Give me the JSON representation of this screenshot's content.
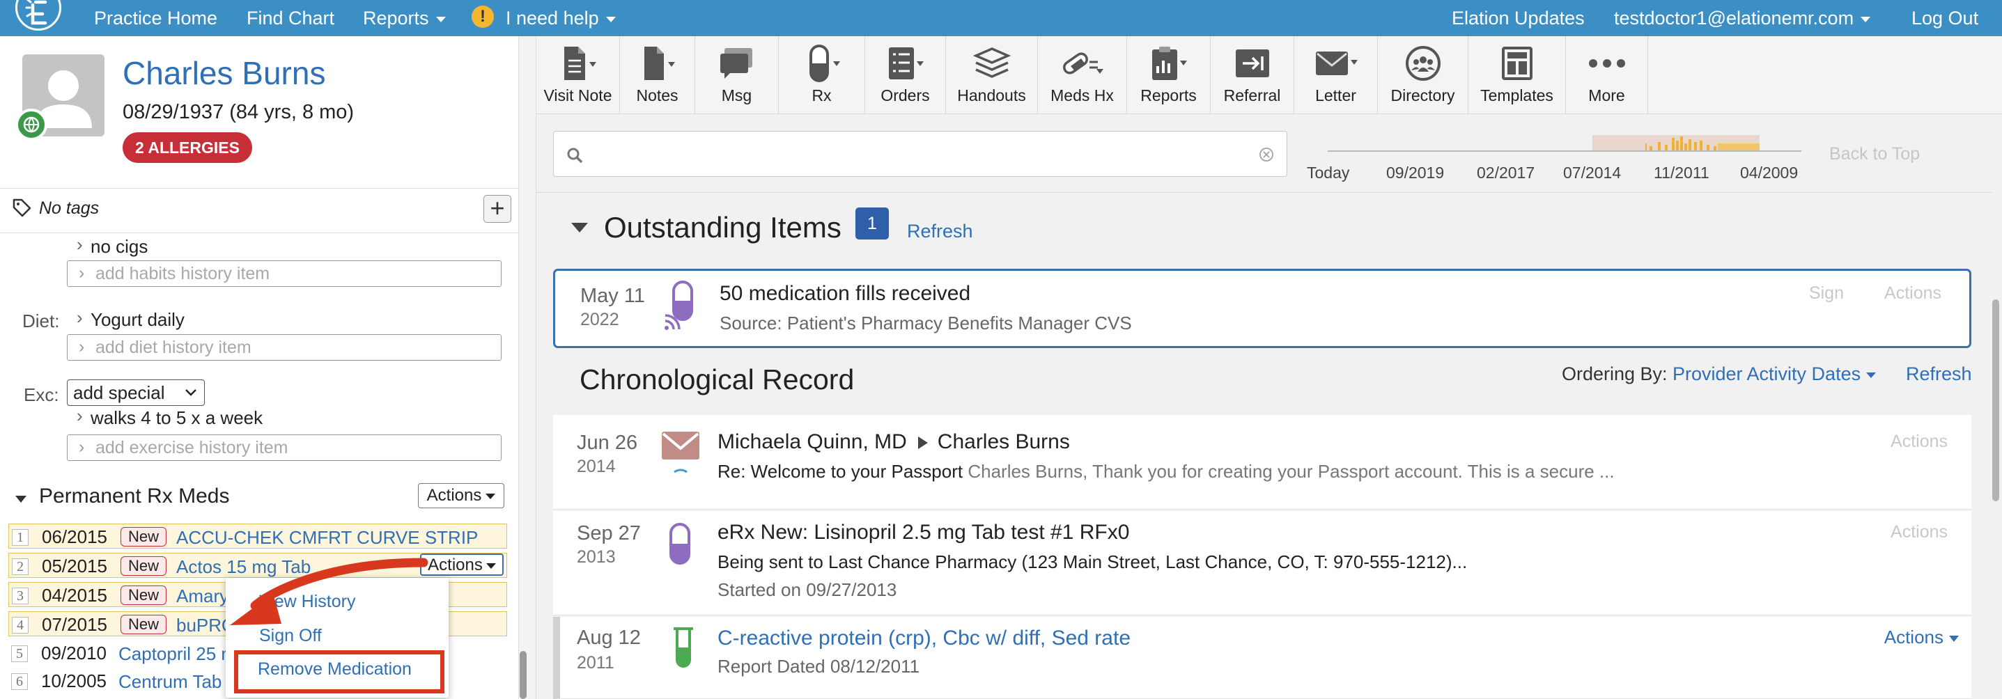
{
  "nav": {
    "practice_home": "Practice Home",
    "find_chart": "Find Chart",
    "reports": "Reports",
    "help": "I need help",
    "updates": "Elation Updates",
    "user": "testdoctor1@elationemr.com",
    "logout": "Log Out"
  },
  "patient": {
    "name": "Charles Burns",
    "dob": "08/29/1937 (84 yrs, 8 mo)",
    "allergies": "2 ALLERGIES",
    "tags": "No tags"
  },
  "history": {
    "habits_value": "no cigs",
    "habits_placeholder": "add habits history item",
    "diet_label": "Diet:",
    "diet_value": "Yogurt daily",
    "diet_placeholder": "add diet history item",
    "exc_label": "Exc:",
    "exc_select": "add special",
    "exc_value": "walks 4 to 5 x a week",
    "exc_placeholder": "add exercise history item"
  },
  "meds": {
    "title": "Permanent Rx Meds",
    "actions": "Actions",
    "row_actions": "Actions",
    "rows": [
      {
        "num": "1",
        "date": "06/2015",
        "badge": "New",
        "name": "ACCU-CHEK CMFRT CURVE STRIP"
      },
      {
        "num": "2",
        "date": "05/2015",
        "badge": "New",
        "name": "Actos 15 mg Tab"
      },
      {
        "num": "3",
        "date": "04/2015",
        "badge": "New",
        "name": "Amaryl"
      },
      {
        "num": "4",
        "date": "07/2015",
        "badge": "New",
        "name": "buPRO"
      },
      {
        "num": "5",
        "date": "09/2010",
        "name": "Captopril 25 m"
      },
      {
        "num": "6",
        "date": "10/2005",
        "name": "Centrum Tab o"
      }
    ]
  },
  "menu": {
    "view_history": "View History",
    "sign_off": "Sign Off",
    "remove_medication": "Remove Medication"
  },
  "toolbar": [
    {
      "label": "Visit Note",
      "icon": "visit-note-icon"
    },
    {
      "label": "Notes",
      "icon": "notes-icon"
    },
    {
      "label": "Msg",
      "icon": "message-icon"
    },
    {
      "label": "Rx",
      "icon": "pill-icon"
    },
    {
      "label": "Orders",
      "icon": "orders-icon"
    },
    {
      "label": "Handouts",
      "icon": "handouts-icon"
    },
    {
      "label": "Meds Hx",
      "icon": "meds-history-icon"
    },
    {
      "label": "Reports",
      "icon": "reports-icon"
    },
    {
      "label": "Referral",
      "icon": "referral-icon"
    },
    {
      "label": "Letter",
      "icon": "letter-icon"
    },
    {
      "label": "Directory",
      "icon": "directory-icon"
    },
    {
      "label": "Templates",
      "icon": "templates-icon"
    },
    {
      "label": "More",
      "icon": "more-icon"
    }
  ],
  "timeline": {
    "ticks": [
      "Today",
      "09/2019",
      "02/2017",
      "07/2014",
      "11/2011",
      "04/2009"
    ],
    "back_to_top": "Back to Top"
  },
  "outstanding": {
    "title": "Outstanding Items",
    "count": "1",
    "refresh": "Refresh",
    "item": {
      "month_day": "May 11",
      "year": "2022",
      "title": "50 medication fills received",
      "source": "Source: Patient's Pharmacy Benefits Manager CVS",
      "sign": "Sign",
      "actions": "Actions"
    }
  },
  "chrono": {
    "title": "Chronological Record",
    "ordering_label": "Ordering By:",
    "ordering_value": "Provider Activity Dates",
    "refresh": "Refresh",
    "records": [
      {
        "month_day": "Jun 26",
        "year": "2014",
        "from": "Michaela Quinn, MD",
        "to": "Charles Burns",
        "subject": "Re: Welcome to your Passport",
        "preview": "Charles Burns, Thank you for creating your Passport account. This is a secure ...",
        "actions": "Actions"
      },
      {
        "month_day": "Sep 27",
        "year": "2013",
        "title": "eRx New: Lisinopril 2.5 mg Tab test #1 RFx0",
        "line1": "Being sent to Last Chance Pharmacy (123 Main Street, Last Chance, CO, T: 970-555-1212)...",
        "line2": "Started on 09/27/2013",
        "actions": "Actions"
      },
      {
        "month_day": "Aug 12",
        "year": "2011",
        "title": "C-reactive protein (crp), Cbc w/ diff, Sed rate",
        "line1": "Report Dated 08/12/2011",
        "actions": "Actions"
      }
    ]
  },
  "colors": {
    "nav_blue": "#3b8fc4",
    "patient_name": "#2e6fb7",
    "allergy_red": "#c62e38",
    "highlight_red": "#d8391e",
    "rx_purple": "#8e6cc0",
    "lab_green": "#4caa50"
  }
}
